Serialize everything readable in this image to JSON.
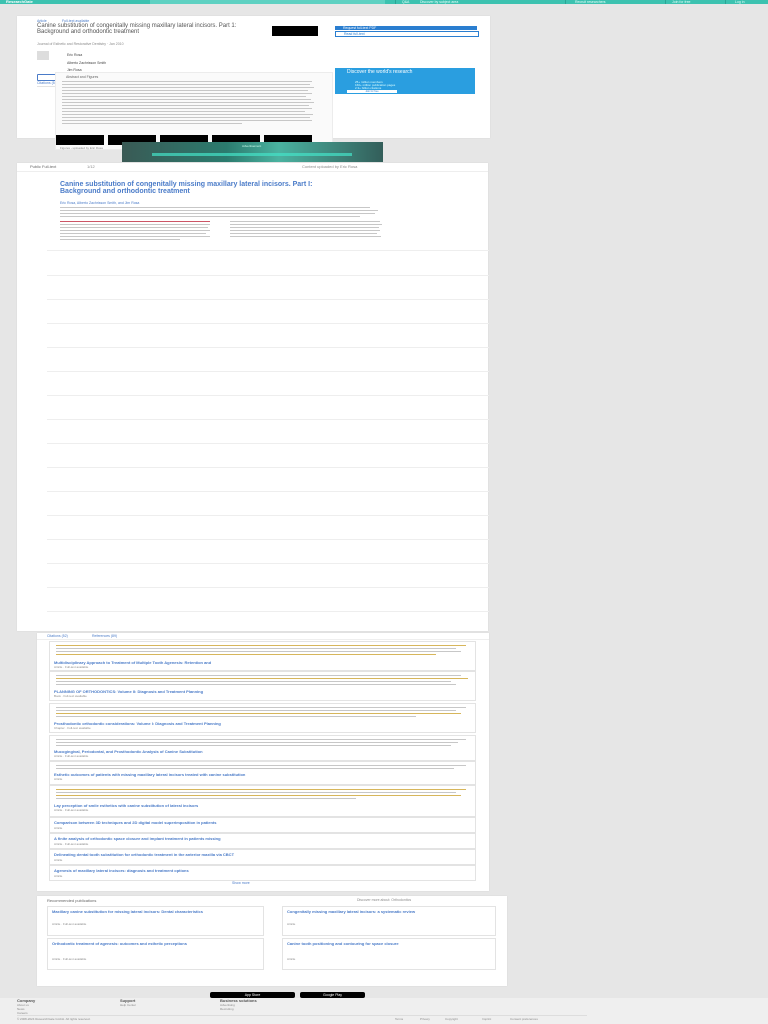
{
  "topbar": {
    "logo": "ResearchGate",
    "search_placeholder": "Search for research, journals, people",
    "items": [
      "Q&A",
      "Discover by subject area",
      "Recruit researchers",
      "Join for free",
      "Log in"
    ]
  },
  "publication": {
    "type_badge": "Article",
    "access_badge": "Full-text available",
    "title": "Canine substitution of congenitally missing maxillary lateral incisors. Part 1: Background and orthodontic treatment",
    "meta": "Journal of Esthetic and Restorative Dentistry · Jan 2010",
    "authors": [
      {
        "name": "Eric Rosa"
      },
      {
        "name": "Alberto Zachrisson Smith"
      },
      {
        "name": "Jim Rosa"
      }
    ],
    "actions": [
      "Download citation",
      "Copy link"
    ],
    "tabs": [
      "Citations (52)",
      "References (89)",
      "Figures (1)"
    ],
    "request_btn": "Request full-text PDF",
    "read_btn": "Read full-text",
    "abstract_heading": "Abstract and Figures",
    "figure_caption": "Figures - uploaded by Eric Rosa",
    "figure_link": "Author content"
  },
  "promo": {
    "title": "Discover the world's research",
    "bullets": [
      "25+ million members",
      "160+ million publication pages",
      "2.3+ billion citations"
    ],
    "cta": "Join for free"
  },
  "banner_ad": {
    "text": "Advertisement"
  },
  "viewer": {
    "source": "Public Full-text",
    "pages": "1/12",
    "header_right": "Content uploaded by Eric Rosa",
    "title": "Canine substitution of congenitally missing maxillary lateral incisors. Part I: Background and orthodontic treatment",
    "authors": "Eric Rosa, Alberto Zachrisson Smith, and Jim Rosa"
  },
  "citations": {
    "tabs": [
      "Citations (52)",
      "References (89)"
    ],
    "items": [
      {
        "title": "Multidisciplinary Approach to Treatment of Multiple Tooth Agenesis: Retention and",
        "meta": "Article · Full-text available"
      },
      {
        "title": "PLANNING OF ORTHODONTICS: Volume II: Diagnosis and Treatment Planning",
        "meta": "Book · Full-text available"
      },
      {
        "title": "Prosthodontic orthodontic considerations: Volume I: Diagnosis and Treatment Planning",
        "meta": "Chapter · Full-text available"
      },
      {
        "title": "Mucogingival, Periodontal, and Prosthodontic Analysis of Canine Substitution",
        "meta": "Article · Full-text available"
      },
      {
        "title": "Esthetic outcomes of patients with missing maxillary lateral incisors treated with canine substitution",
        "meta": "Article"
      },
      {
        "title": "Lay perception of smile esthetics with canine substitution of lateral incisors",
        "meta": "Article · Full-text available"
      },
      {
        "title": "Comparison between 3D techniques and 2D digital model superimposition in patients",
        "meta": "Article"
      },
      {
        "title": "A finite analysis of orthodontic space closure and implant treatment in patients missing",
        "meta": "Article · Full-text available"
      },
      {
        "title": "Delineating dental tooth substitution for orthodontic treatment in the anterior maxilla via CBCT",
        "meta": "Article"
      },
      {
        "title": "Agenesis of maxillary lateral incisors: diagnosis and treatment options",
        "meta": "Article"
      }
    ],
    "more": "Show more"
  },
  "recommended": {
    "heading": "Recommended publications",
    "discover_more": "Discover more about: Orthodontics",
    "items": [
      {
        "title": "Maxillary canine substitution for missing lateral incisors: Dental characteristics",
        "meta": "Article · Full-text available"
      },
      {
        "title": "Congenitally missing maxillary lateral incisors: a systematic review",
        "meta": "Article"
      },
      {
        "title": "Orthodontic treatment of agenesis: outcomes and esthetic perceptions",
        "meta": "Article · Full-text available"
      },
      {
        "title": "Canine tooth positioning and contouring for space closure",
        "meta": "Article"
      }
    ]
  },
  "footer": {
    "columns": [
      {
        "heading": "Company",
        "items": [
          "About us",
          "News",
          "Careers"
        ]
      },
      {
        "heading": "Support",
        "items": [
          "Help Center"
        ]
      },
      {
        "heading": "Business solutions",
        "items": [
          "Advertising",
          "Recruiting"
        ]
      }
    ],
    "stores": [
      "App Store",
      "Google Play"
    ],
    "copyright": "© 2008-2024 ResearchGate GmbH. All rights reserved.",
    "links": [
      "Terms",
      "Privacy",
      "Copyright",
      "Imprint",
      "Consent preferences"
    ]
  },
  "colors": {
    "teal": "#3cc2b0",
    "blue": "#2a7ed0",
    "link": "#4a7bc8"
  }
}
